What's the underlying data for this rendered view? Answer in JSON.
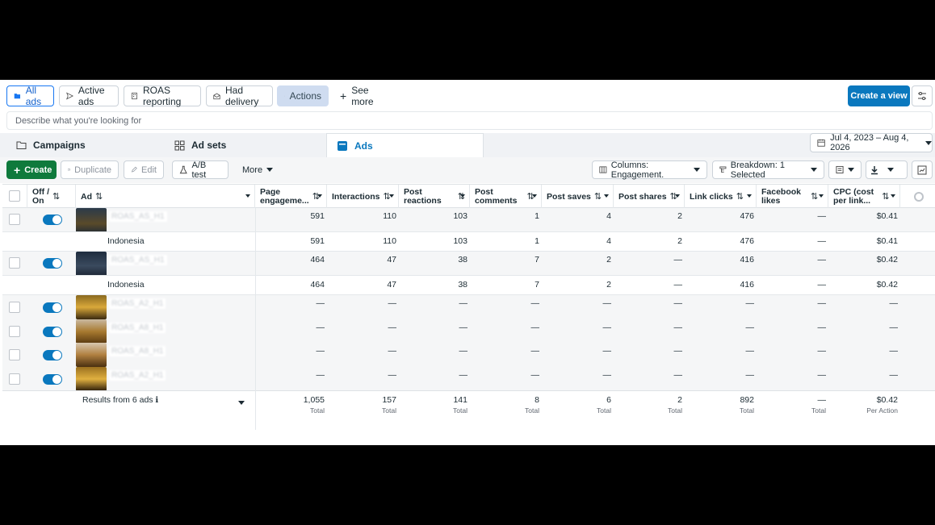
{
  "viewbar": {
    "buttons": [
      "All ads",
      "Active ads",
      "ROAS reporting",
      "Had delivery",
      "Actions",
      "See more"
    ],
    "create_view": "Create a view"
  },
  "search": {
    "placeholder": "Describe what you're looking for"
  },
  "level_tabs": [
    "Campaigns",
    "Ad sets",
    "Ads"
  ],
  "date_range": "Jul 4, 2023 – Aug 4, 2026",
  "actions": {
    "create": "Create",
    "duplicate": "Duplicate",
    "edit": "Edit",
    "ab_test": "A/B test",
    "more": "More",
    "columns": "Columns: Engagement.",
    "breakdown": "Breakdown: 1 Selected"
  },
  "table": {
    "headers": {
      "offon": [
        "Off /",
        "On"
      ],
      "ad": "Ad",
      "page_engagement": [
        "Page",
        "engageme..."
      ],
      "interactions": "Interactions",
      "post_reactions": [
        "Post",
        "reactions"
      ],
      "post_comments": [
        "Post",
        "comments"
      ],
      "post_saves": "Post saves",
      "post_shares": "Post shares",
      "link_clicks": "Link clicks",
      "facebook_likes": [
        "Facebook",
        "likes"
      ],
      "cpc": [
        "CPC (cost",
        "per link..."
      ]
    },
    "rows": [
      {
        "name": "ROAS_AS_H1",
        "values": [
          "591",
          "110",
          "103",
          "1",
          "4",
          "2",
          "476",
          "—",
          "$0.41"
        ],
        "breakdown": {
          "label": "Indonesia",
          "values": [
            "591",
            "110",
            "103",
            "1",
            "4",
            "2",
            "476",
            "—",
            "$0.41"
          ]
        }
      },
      {
        "name": "ROAS_AS_H1",
        "values": [
          "464",
          "47",
          "38",
          "7",
          "2",
          "—",
          "416",
          "—",
          "$0.42"
        ],
        "breakdown": {
          "label": "Indonesia",
          "values": [
            "464",
            "47",
            "38",
            "7",
            "2",
            "—",
            "416",
            "—",
            "$0.42"
          ]
        }
      },
      {
        "name": "ROAS_A2_H1",
        "values": [
          "—",
          "—",
          "—",
          "—",
          "—",
          "—",
          "—",
          "—",
          "—"
        ]
      },
      {
        "name": "ROAS_A8_H1",
        "values": [
          "—",
          "—",
          "—",
          "—",
          "—",
          "—",
          "—",
          "—",
          "—"
        ]
      },
      {
        "name": "ROAS_A8_H1",
        "values": [
          "—",
          "—",
          "—",
          "—",
          "—",
          "—",
          "—",
          "—",
          "—"
        ]
      },
      {
        "name": "ROAS_A2_H1",
        "values": [
          "—",
          "—",
          "—",
          "—",
          "—",
          "—",
          "—",
          "—",
          "—"
        ]
      }
    ],
    "results": {
      "label": "Results from 6 ads",
      "values": [
        "1,055",
        "157",
        "141",
        "8",
        "6",
        "2",
        "892",
        "—",
        "$0.42"
      ],
      "sublabels": [
        "Total",
        "Total",
        "Total",
        "Total",
        "Total",
        "Total",
        "Total",
        "Total",
        "Per Action"
      ]
    }
  },
  "colors": {
    "accent": "#0a78be",
    "create_green": "#0f7a3c",
    "actions_bg": "#cfdcf0"
  }
}
